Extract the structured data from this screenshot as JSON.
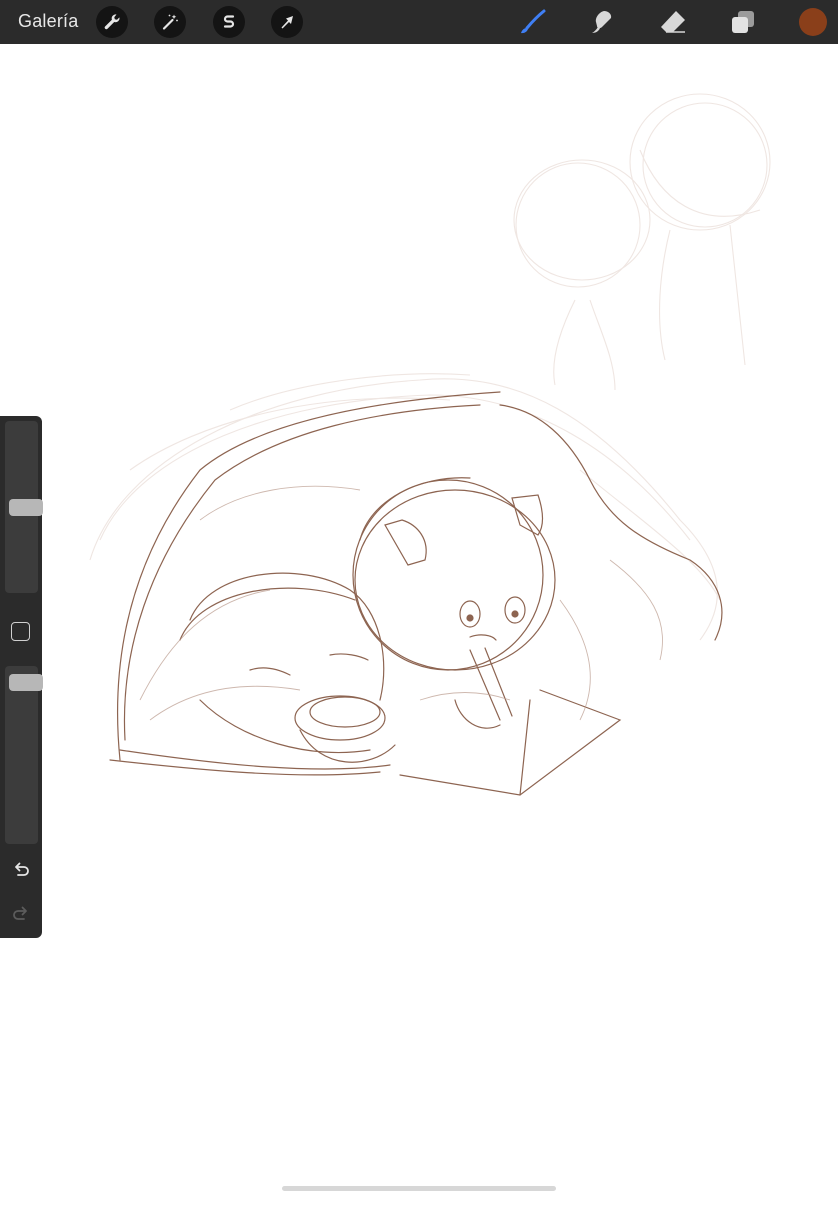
{
  "app": {
    "gallery_label": "Galería"
  },
  "toolbar": {
    "left_tools": [
      {
        "icon": "wrench-icon",
        "name": "actions"
      },
      {
        "icon": "magic-wand-icon",
        "name": "adjustments"
      },
      {
        "icon": "selection-s-icon",
        "name": "selection"
      },
      {
        "icon": "arrow-cursor-icon",
        "name": "transform"
      }
    ],
    "right_tools": [
      {
        "icon": "brush-icon",
        "name": "paint",
        "active": true
      },
      {
        "icon": "smudge-icon",
        "name": "smudge",
        "active": false
      },
      {
        "icon": "eraser-icon",
        "name": "erase",
        "active": false
      },
      {
        "icon": "layers-icon",
        "name": "layers",
        "active": false
      }
    ],
    "current_color": "#8a3f1a"
  },
  "colors": {
    "bar": "#2b2b2b",
    "active_tool": "#3f7ff5",
    "sketch": "#7a4a33"
  },
  "sidebar": {
    "brush_size_level": 0.5,
    "opacity_level": 0.95,
    "modify_icon": "square-modify-icon",
    "undo_icon": "undo-icon",
    "redo_icon": "redo-icon",
    "redo_enabled": false
  }
}
